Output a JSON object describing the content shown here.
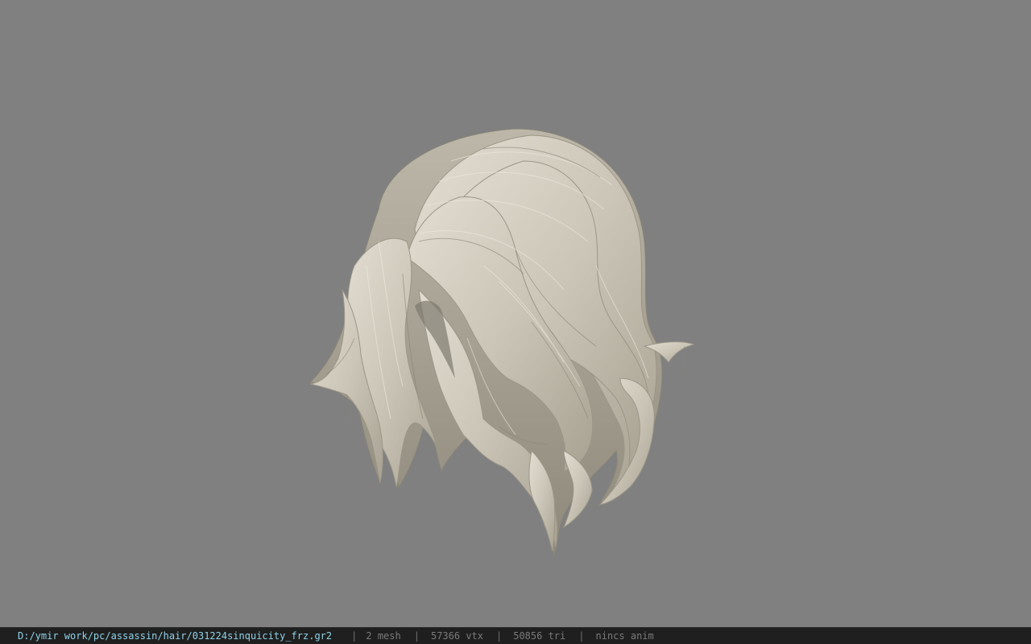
{
  "viewport": {
    "background_color": "#808080",
    "model_color": "#cbc5b7",
    "model_shadow_color": "#8f897c",
    "model_highlight_color": "#e2ddd1",
    "model_icon": "hair-mesh-icon"
  },
  "status_bar": {
    "file_path": "D:/ymir work/pc/assassin/hair/031224sinquicity_frz.gr2",
    "separator": "|",
    "mesh_count": "2 mesh",
    "vertex_count": "57366 vtx",
    "triangle_count": "50856 tri",
    "anim_status": "nincs anim",
    "path_color": "#8fd3e8",
    "text_color": "#7a7a7a",
    "background_color": "#1f1f1f"
  }
}
